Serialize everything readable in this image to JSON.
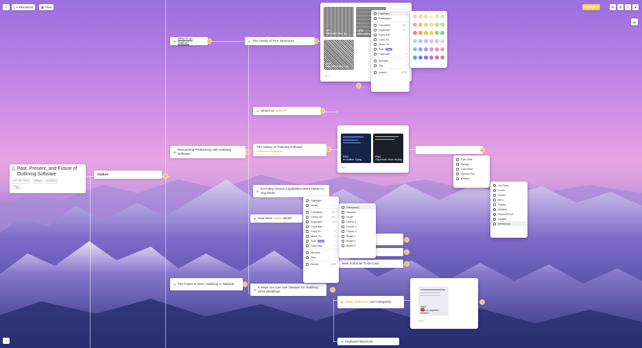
{
  "toolbar": {
    "back_label": "Resources",
    "view_label": "View",
    "highlight_btn": "Highlight"
  },
  "root": {
    "title": "Past, Present, and Future of Outlining Software",
    "date": "04 / 15 / 2023",
    "meta_user": "Alinga",
    "meta_tag": "#outlines",
    "tag_chip": "Tag"
  },
  "outline_label": "Outline",
  "nodes": {
    "what_is_outline": "What is an Outline?",
    "family": "The Family of Tree Structures",
    "whats_an_outline": "What's an",
    "whats_an_outline_hl": "outline",
    "reinventing": "Reinventing Productivity with Outlining Software",
    "history": "The History of Outlining Software",
    "history_sub": "Outliners ▸ Infographic",
    "everyday": "Everyday Genius Capabilities Were Hidden in Org Mode",
    "how_does": "How Does",
    "how_does_hl": "Notion",
    "how_does_tail": "Work?",
    "future": "The Future Is Here: Outlining in Taskade",
    "ways": "6 Ways You Can Use Taskade for Outlining 2023 Workflows",
    "next_action": "Next Action as To-Do Lists",
    "ideas": "Ideas, Reference",
    "ideas_tail": "and Categories",
    "shortcuts": "Keyboard Shortcuts"
  },
  "images_top": [
    {
      "kind": "JPG",
      "name": "Alternative tool.jpg"
    },
    {
      "kind": "JPG",
      "name": "Alternative tool2.jpg"
    },
    {
      "kind": "PNG",
      "name": "Alternative one.png"
    }
  ],
  "images_mid": [
    {
      "kind": "PNG",
      "name": "ex-outline 3.png"
    },
    {
      "kind": "PNG",
      "name": "Org mode show all.png"
    }
  ],
  "image_low": {
    "kind": "PNG",
    "name": "How to organize Notion?"
  },
  "counters": {
    "top": "1",
    "mid": "1",
    "low": "1"
  },
  "context_menu_top": [
    {
      "label": "Highlight",
      "arrow": "›",
      "icon": "highlight-icon"
    },
    {
      "label": "Paragraph",
      "arrow": "›",
      "icon": "paragraph-icon"
    },
    {
      "sep": true
    },
    {
      "label": "Complete",
      "key": "⌘↵",
      "icon": "check-icon"
    },
    {
      "label": "Duplicate",
      "key": "⌘D",
      "icon": "duplicate-icon"
    },
    {
      "label": "Copy link",
      "icon": "link-icon"
    },
    {
      "label": "Copy To",
      "arrow": "›",
      "icon": "copy-icon"
    },
    {
      "label": "Move To",
      "arrow": "›",
      "icon": "move-icon"
    },
    {
      "label": "Sort",
      "badge": "New",
      "arrow": "›",
      "icon": "sort-icon"
    },
    {
      "label": "Calendar",
      "arrow": "›",
      "icon": "calendar-icon"
    },
    {
      "sep": true
    },
    {
      "label": "Mention",
      "arrow": "›",
      "icon": "mention-icon"
    },
    {
      "label": "Tag",
      "arrow": "›",
      "icon": "tag-icon"
    },
    {
      "sep": true
    },
    {
      "label": "Delete",
      "key": "⌘⌫",
      "icon": "trash-icon"
    }
  ],
  "context_menu_mid": [
    {
      "label": "Highlight",
      "arrow": "›",
      "icon": "highlight-icon"
    },
    {
      "label": "Order",
      "arrow": "›",
      "icon": "order-icon"
    },
    {
      "sep": true
    },
    {
      "label": "Complete",
      "key": "⌘↵",
      "icon": "check-icon"
    },
    {
      "label": "Check All",
      "key": "⌘⇧",
      "icon": "check-all-icon"
    },
    {
      "label": "Duplicate",
      "key": "⌘D",
      "icon": "duplicate-icon"
    },
    {
      "label": "Copy link",
      "icon": "link-icon"
    },
    {
      "label": "Copy To",
      "arrow": "›",
      "icon": "copy-icon"
    },
    {
      "label": "Move To",
      "arrow": "›",
      "icon": "move-icon"
    },
    {
      "label": "Sort",
      "badge": "New",
      "arrow": "›",
      "icon": "sort-icon"
    },
    {
      "label": "Calendar",
      "arrow": "›",
      "icon": "calendar-icon"
    },
    {
      "sep": true
    },
    {
      "label": "Mention",
      "arrow": "›",
      "icon": "mention-icon"
    },
    {
      "label": "Tag",
      "arrow": "›",
      "icon": "tag-icon"
    },
    {
      "sep": true
    },
    {
      "label": "Delete",
      "key": "⌘⌫",
      "icon": "trash-icon"
    }
  ],
  "format_submenu": [
    {
      "label": "Paragraph"
    },
    {
      "label": "Number"
    },
    {
      "label": "Order"
    },
    {
      "label": "Check 1"
    },
    {
      "label": "Check 2"
    },
    {
      "label": "Check 3"
    },
    {
      "label": "Bullet 1"
    },
    {
      "label": "Bullet 2"
    },
    {
      "label": "Bullet 3"
    }
  ],
  "add_menu": [
    {
      "label": "Due Date",
      "icon": "date-icon"
    },
    {
      "label": "Assign",
      "icon": "assign-icon"
    },
    {
      "label": "Comment",
      "icon": "comment-icon"
    },
    {
      "label": "Upload File",
      "icon": "upload-icon"
    },
    {
      "label": "Embed",
      "icon": "embed-icon",
      "arrow": "›"
    }
  ],
  "embed_menu": [
    "YouTube",
    "Loom",
    "Vimeo",
    "Miro",
    "Figma",
    "Airtable",
    "SoundCloud",
    "Spotify",
    "Whimsical"
  ],
  "colors": {
    "accent": "#f2c94c",
    "palette": [
      "#f7c6c6",
      "#f8d3b6",
      "#f9e2a8",
      "#f7f0a9",
      "#d8efb2",
      "#c7ecd7",
      "#f4a4a4",
      "#f5b987",
      "#f7cf74",
      "#f0e178",
      "#b9e28a",
      "#a3dcc0",
      "#ee7e7e",
      "#f09e5f",
      "#f2bb45",
      "#e8d34b",
      "#97d162",
      "#7fcca6",
      "#b9d6f5",
      "#b8c4f5",
      "#cbbaf5",
      "#e4b9f2",
      "#f2b8d9",
      "#d8d8d8",
      "#8ebdf0",
      "#8fa2ee",
      "#ad93ee",
      "#d592ea",
      "#ec8dc1",
      "#bcbcbc",
      "#5f9fe8",
      "#6a80e6",
      "#8f6de6",
      "#c46ae0",
      "#e465a8",
      "#9a9a9a"
    ]
  }
}
